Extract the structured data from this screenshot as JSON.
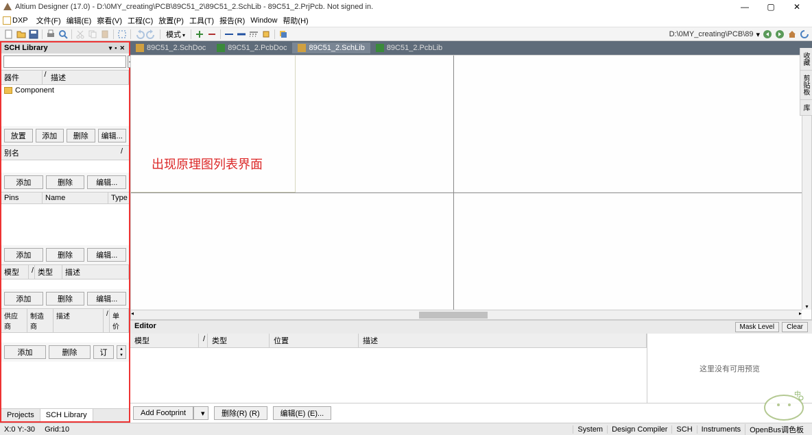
{
  "title": "Altium Designer (17.0) - D:\\0MY_creating\\PCB\\89C51_2\\89C51_2.SchLib - 89C51_2.PrjPcb. Not signed in.",
  "menu": {
    "dxp": "DXP",
    "items": [
      "文件(F)",
      "编辑(E)",
      "察看(V)",
      "工程(C)",
      "放置(P)",
      "工具(T)",
      "报告(R)",
      "Window",
      "帮助(H)"
    ]
  },
  "toolbar": {
    "mode": "模式"
  },
  "right_path": "D:\\0MY_creating\\PCB\\89",
  "left": {
    "title": "SCH Library",
    "cols": {
      "device": "器件",
      "desc": "描述"
    },
    "component": "Component",
    "btns1": {
      "place": "放置",
      "add": "添加",
      "del": "删除",
      "edit": "编辑..."
    },
    "alias": "别名",
    "btns2": {
      "add": "添加",
      "del": "删除",
      "edit": "编辑..."
    },
    "pins": {
      "pins": "Pins",
      "name": "Name",
      "type": "Type"
    },
    "btns3": {
      "add": "添加",
      "del": "删除",
      "edit": "编辑..."
    },
    "model": {
      "model": "模型",
      "type": "类型",
      "desc": "描述"
    },
    "btns4": {
      "add": "添加",
      "del": "删除",
      "edit": "编辑..."
    },
    "supplier": {
      "vendor": "供应商",
      "mfr": "制造商",
      "desc": "描述",
      "price": "单价"
    },
    "btns5": {
      "add": "添加",
      "del": "删除",
      "order": "订"
    },
    "tabs": {
      "projects": "Projects",
      "schlib": "SCH Library"
    }
  },
  "doc_tabs": [
    "89C51_2.SchDoc",
    "89C51_2.PcbDoc",
    "89C51_2.SchLib",
    "89C51_2.PcbLib"
  ],
  "annotation": "出现原理图列表界面",
  "editor": {
    "title": "Editor",
    "mask": "Mask Level",
    "clear": "Clear",
    "cols": {
      "model": "模型",
      "type": "类型",
      "pos": "位置",
      "desc": "描述"
    },
    "preview": "这里没有可用预览",
    "btns": {
      "addfp": "Add Footprint",
      "del": "删除(R) (R)",
      "edit": "编辑(E) (E)..."
    }
  },
  "right_tabs": [
    "收藏",
    "剪贴板",
    "库"
  ],
  "status": {
    "coord": "X:0 Y:-30",
    "grid": "Grid:10",
    "tabs": [
      "System",
      "Design Compiler",
      "SCH",
      "Instruments",
      "OpenBus调色板"
    ]
  }
}
